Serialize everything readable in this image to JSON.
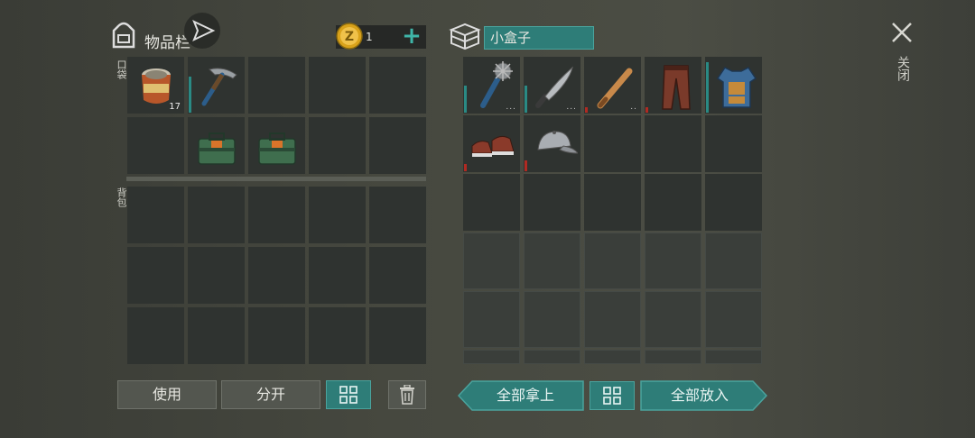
{
  "inventory": {
    "title": "物品栏",
    "coin_count": "1",
    "pocket_label": "口袋",
    "backpack_label": "背包",
    "pocket_items": [
      {
        "slot": 0,
        "name": "canned-food",
        "count": "17"
      },
      {
        "slot": 1,
        "name": "pickaxe",
        "count": ""
      },
      {
        "slot": 6,
        "name": "green-toolbox",
        "count": ""
      },
      {
        "slot": 7,
        "name": "green-toolbox",
        "count": ""
      }
    ]
  },
  "container": {
    "name": "小盒子",
    "items": [
      {
        "slot": 0,
        "name": "spiked-club",
        "count": "..."
      },
      {
        "slot": 1,
        "name": "machete",
        "count": "..."
      },
      {
        "slot": 2,
        "name": "baseball-bat",
        "count": ".."
      },
      {
        "slot": 3,
        "name": "leather-pants",
        "count": ""
      },
      {
        "slot": 4,
        "name": "armor-vest",
        "count": ""
      },
      {
        "slot": 5,
        "name": "sneakers",
        "count": ""
      },
      {
        "slot": 6,
        "name": "baseball-cap",
        "count": ""
      }
    ]
  },
  "buttons": {
    "use": "使用",
    "split": "分开",
    "take_all": "全部拿上",
    "put_all": "全部放入",
    "close": "关闭"
  },
  "colors": {
    "accent_teal": "#2e7d78",
    "durability_red": "#b02a22",
    "durability_teal": "#2a8a84"
  }
}
